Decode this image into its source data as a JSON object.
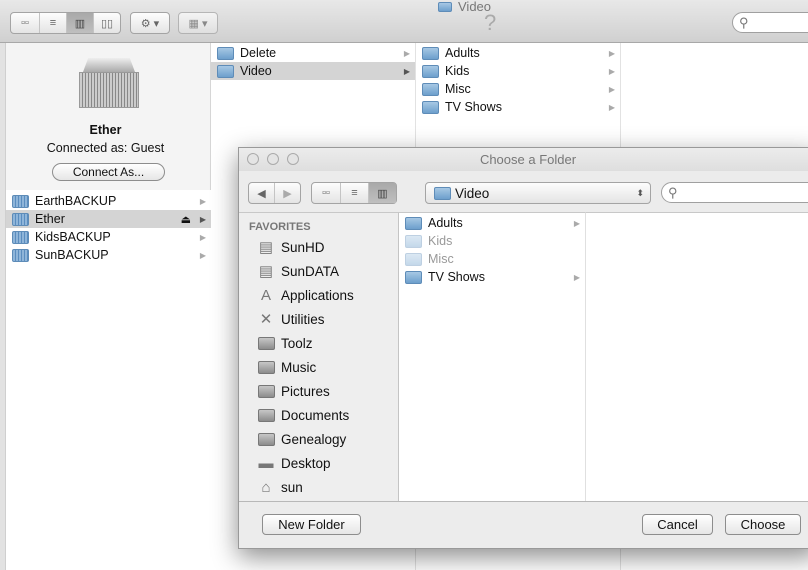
{
  "window": {
    "title": "Video",
    "help": "?"
  },
  "toolbar": {
    "view_icons": "▫▫",
    "view_list": "≡",
    "view_columns": "▥",
    "view_coverflow": "▯▯",
    "action": "⚙ ▾",
    "arrange": "▦ ▾"
  },
  "server": {
    "name": "Ether",
    "status": "Connected as: Guest",
    "connect_button": "Connect As..."
  },
  "shared": [
    {
      "label": "EarthBACKUP"
    },
    {
      "label": "Ether",
      "selected": true,
      "eject": "⏏"
    },
    {
      "label": "KidsBACKUP"
    },
    {
      "label": "SunBACKUP"
    }
  ],
  "column1": [
    {
      "label": "Delete"
    },
    {
      "label": "Video",
      "selected": true
    }
  ],
  "column2": [
    {
      "label": "Adults"
    },
    {
      "label": "Kids"
    },
    {
      "label": "Misc"
    },
    {
      "label": "TV Shows"
    }
  ],
  "dialog": {
    "title": "Choose a Folder",
    "path": "Video",
    "favorites_header": "FAVORITES",
    "favorites": [
      {
        "label": "SunHD",
        "icon": "drive"
      },
      {
        "label": "SunDATA",
        "icon": "drive"
      },
      {
        "label": "Applications",
        "icon": "applications"
      },
      {
        "label": "Utilities",
        "icon": "utilities"
      },
      {
        "label": "Toolz",
        "icon": "folder"
      },
      {
        "label": "Music",
        "icon": "folder"
      },
      {
        "label": "Pictures",
        "icon": "folder"
      },
      {
        "label": "Documents",
        "icon": "folder"
      },
      {
        "label": "Genealogy",
        "icon": "folder"
      },
      {
        "label": "Desktop",
        "icon": "desktop"
      },
      {
        "label": "sun",
        "icon": "home"
      }
    ],
    "items": [
      {
        "label": "Adults",
        "enabled": true
      },
      {
        "label": "Kids",
        "enabled": false
      },
      {
        "label": "Misc",
        "enabled": false
      },
      {
        "label": "TV Shows",
        "enabled": true
      }
    ],
    "new_folder": "New Folder",
    "cancel": "Cancel",
    "choose": "Choose"
  }
}
